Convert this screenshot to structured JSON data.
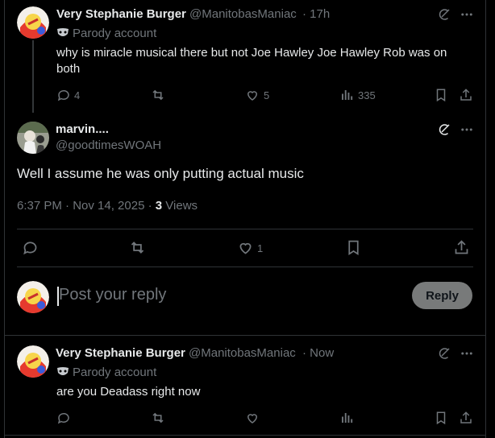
{
  "tweet1": {
    "display_name": "Very Stephanie Burger",
    "handle": "@ManitobasManiac",
    "time": "· 17h",
    "parody_label": "Parody account",
    "text": "why is miracle musical there but not Joe Hawley Joe Hawley Rob was on both",
    "replies": "4",
    "likes": "5",
    "views": "335"
  },
  "main_tweet": {
    "display_name": "marvin....",
    "handle": "@goodtimesWOAH",
    "text": "Well I assume he was only putting actual music",
    "timestamp": "6:37 PM · Nov 14, 2025 ·",
    "views_count": "3",
    "views_label": "Views",
    "likes": "1"
  },
  "composer": {
    "placeholder": "Post your reply",
    "reply_button": "Reply"
  },
  "tweet2": {
    "display_name": "Very Stephanie Burger",
    "handle": "@ManitobasManiac",
    "time": "· Now",
    "parody_label": "Parody account",
    "text": "are you Deadass right now"
  },
  "colors": {
    "background": "#000000",
    "text": "#e7e9ea",
    "muted": "#71767b",
    "border": "#2f3336",
    "reply_button_bg": "#787a7a"
  },
  "icons": [
    "grok-icon",
    "more-icon",
    "mask-icon",
    "reply-icon",
    "repost-icon",
    "like-icon",
    "views-icon",
    "bookmark-icon",
    "share-icon"
  ]
}
